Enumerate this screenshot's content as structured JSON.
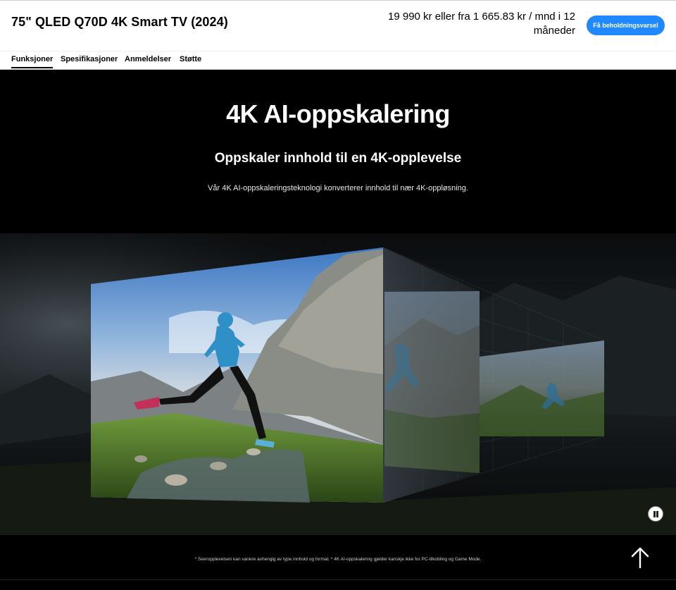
{
  "header": {
    "product_title": "75\" QLED Q70D 4K Smart TV (2024)",
    "price_line1": "19 990 kr eller fra 1 665.83 kr / mnd i 12",
    "price_line2": "måneder",
    "stock_button_label": "Få beholdningsvarsel",
    "accent_color": "#2189ff"
  },
  "tabs": [
    {
      "label": "Funksjoner",
      "active": true
    },
    {
      "label": "Spesifikasjoner",
      "active": false
    },
    {
      "label": "Anmeldelser",
      "active": false
    },
    {
      "label": "Støtte",
      "active": false
    }
  ],
  "hero": {
    "title": "4K AI-oppskalering",
    "subtitle": "Oppskaler innhold til en 4K-opplevelse",
    "description": "Vår 4K AI-oppskaleringsteknologi konverterer innhold til nær 4K-oppløsning."
  },
  "controls": {
    "pause_icon": "pause-icon",
    "back_to_top_icon": "arrow-up-icon"
  },
  "footnote": "* Seeropplevelsen kan variere avhengig av type innhold og format. * 4K AI-oppskalering gjelder kanskje ikke for PC-tilkobling og Game Mode."
}
